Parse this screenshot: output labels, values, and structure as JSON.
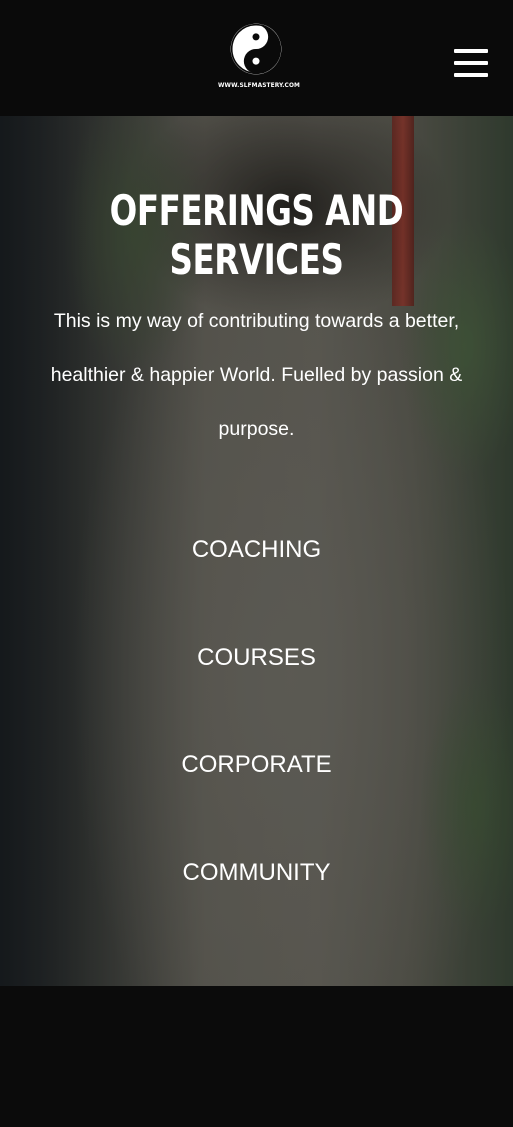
{
  "header": {
    "logo_icon": "yin-yang-icon",
    "logo_text": "WWW.SLFMASTERY.COM",
    "menu_icon": "hamburger-menu-icon"
  },
  "hero": {
    "title": "OFFERINGS AND SERVICES",
    "intro": "This is my way of contributing towards a better, healthier & happier World. Fuelled by passion & purpose.",
    "services": [
      "COACHING",
      "COURSES",
      "CORPORATE",
      "COMMUNITY"
    ]
  },
  "colors": {
    "header_bg": "#0a0a0a",
    "text": "#ffffff",
    "footer_bg": "#0b0b0b"
  }
}
